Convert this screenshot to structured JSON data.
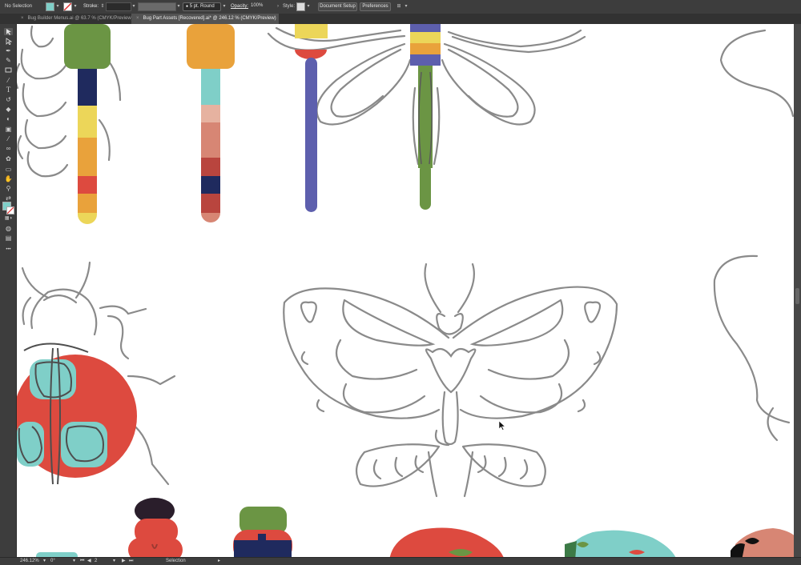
{
  "control_bar": {
    "selection_label": "No Selection",
    "fill_color": "#7fcfc8",
    "stroke_label": "Stroke:",
    "stroke_weight": "",
    "brush_label": "5 pt. Round",
    "opacity_label": "Opacity:",
    "opacity_value": "100%",
    "style_label": "Style:",
    "document_setup_label": "Document Setup",
    "preferences_label": "Preferences"
  },
  "tabs": [
    {
      "label": "Bug Builder Menus.ai @ 63.7 % (CMYK/Preview)",
      "active": false
    },
    {
      "label": "Bug Part Assets [Recovered].ai* @ 246.12 % (CMYK/Preview)",
      "active": true
    }
  ],
  "toolbar": {
    "tools": [
      "selection-tool",
      "direct-selection-tool",
      "pen-tool",
      "curvature-tool",
      "rectangle-tool",
      "paintbrush-tool",
      "type-tool",
      "rotate-tool",
      "eraser-tool",
      "shape-builder-tool",
      "gradient-tool",
      "eyedropper-tool",
      "blend-tool",
      "symbol-sprayer-tool",
      "artboard-tool",
      "hand-tool",
      "zoom-tool"
    ],
    "more_label": "•••"
  },
  "status_bar": {
    "zoom": "246.12%",
    "rotation": "0°",
    "artboard_number": "2",
    "tool_name": "Selection"
  },
  "colors": {
    "teal": "#7fcfc8",
    "red": "#dd4a3f",
    "navy": "#1f2a5e",
    "yellow": "#ecd659",
    "orange": "#e9a23b",
    "green": "#6b9544",
    "purple": "#5d5fad",
    "pink": "#d78674",
    "dark_plum": "#2a1e2b",
    "sketch_gray": "#8a8a8a"
  }
}
